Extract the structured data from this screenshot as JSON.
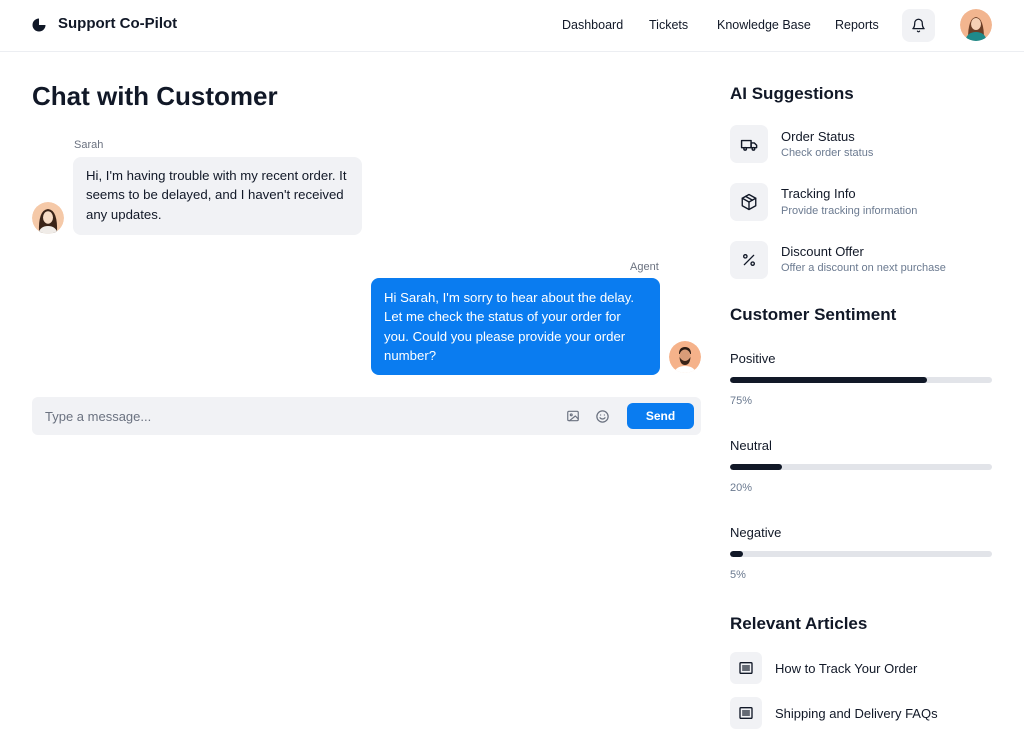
{
  "header": {
    "app_title": "Support Co-Pilot",
    "nav": [
      {
        "label": "Dashboard"
      },
      {
        "label": "Tickets"
      },
      {
        "label": "Knowledge Base"
      },
      {
        "label": "Reports"
      }
    ],
    "icons": {
      "logo": "logo-icon",
      "notifications": "bell-icon",
      "avatar": "user-avatar"
    }
  },
  "chat": {
    "title": "Chat with Customer",
    "messages": [
      {
        "sender": "Sarah",
        "role": "customer",
        "text": "Hi, I'm having trouble with my recent order. It seems to be delayed, and I haven't received any updates."
      },
      {
        "sender": "Agent",
        "role": "agent",
        "text": "Hi Sarah, I'm sorry to hear about the delay. Let me check the status of your order for you. Could you please provide your order number?"
      }
    ],
    "composer": {
      "placeholder": "Type a message...",
      "value": "",
      "send_label": "Send"
    }
  },
  "suggestions": {
    "title": "AI Suggestions",
    "items": [
      {
        "title": "Order Status",
        "description": "Check order status",
        "icon": "truck-icon"
      },
      {
        "title": "Tracking Info",
        "description": "Provide tracking information",
        "icon": "package-icon"
      },
      {
        "title": "Discount Offer",
        "description": "Offer a discount on next purchase",
        "icon": "percent-icon"
      }
    ]
  },
  "sentiment": {
    "title": "Customer Sentiment",
    "items": [
      {
        "label": "Positive",
        "percent_label": "75%",
        "value": 75
      },
      {
        "label": "Neutral",
        "percent_label": "20%",
        "value": 20
      },
      {
        "label": "Negative",
        "percent_label": "5%",
        "value": 5
      }
    ]
  },
  "articles": {
    "title": "Relevant Articles",
    "items": [
      {
        "title": "How to Track Your Order",
        "icon": "article-icon"
      },
      {
        "title": "Shipping and Delivery FAQs",
        "icon": "article-icon"
      }
    ]
  },
  "colors": {
    "accent": "#0a7cf0",
    "bar_fill": "#111827",
    "bar_track": "#e2e4e9",
    "surface": "#f1f2f5"
  }
}
